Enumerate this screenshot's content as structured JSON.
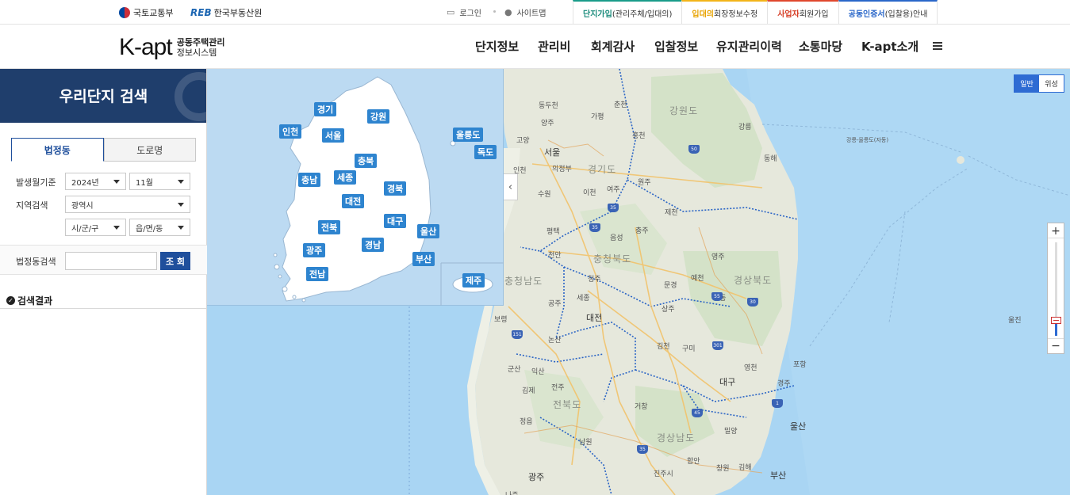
{
  "utility": {
    "gov_name": "국토교통부",
    "reb_mark": "REB",
    "reb_name": "한국부동산원",
    "login": "로그인",
    "sitemap": "사이트맵"
  },
  "tabs": [
    {
      "hl": "단지가입",
      "rest": "(관리주체/입대의)"
    },
    {
      "hl": "입대의",
      "rest": "회장정보수정"
    },
    {
      "hl": "사업자",
      "rest": " 회원가입"
    },
    {
      "hl": "공동인증서",
      "rest": "(입찰용)안내"
    }
  ],
  "header": {
    "logo_text": "K-apt",
    "logo_sub1": "공동주택관리",
    "logo_sub2": "정보시스템",
    "nav": [
      "단지정보",
      "관리비",
      "회계감사",
      "입찰정보",
      "유지관리이력",
      "소통마당",
      "K-apt소개"
    ]
  },
  "sidebar": {
    "title": "우리단지 검색",
    "tab_active": "법정동",
    "tab_other": "도로명",
    "period_label": "발생월기준",
    "year_value": "2024년",
    "month_value": "11월",
    "region_label": "지역검색",
    "sido_value": "광역시",
    "sigungu_value": "시/군/구",
    "emd_value": "읍/면/동",
    "dong_search_label": "법정동검색",
    "search_button": "조 회",
    "result_title": "검색결과"
  },
  "map": {
    "maptype_normal": "일반",
    "maptype_satellite": "위성",
    "collapse_arrow": "‹",
    "zoom_in": "+",
    "zoom_out": "−",
    "regions": [
      "경기",
      "강원",
      "인천",
      "서울",
      "울릉도",
      "독도",
      "충북",
      "충남",
      "세종",
      "경북",
      "대전",
      "대구",
      "전북",
      "울산",
      "경남",
      "광주",
      "부산",
      "전남",
      "제주"
    ],
    "provinces": [
      "강원도",
      "경기도",
      "충청북도",
      "충청남도",
      "경상북도",
      "전북도",
      "경상남도"
    ],
    "places": [
      "동두천",
      "춘천",
      "양주",
      "가평",
      "고양",
      "서울",
      "홍천",
      "강릉",
      "동해",
      "인천",
      "의정부",
      "수원",
      "이천",
      "여주",
      "원주",
      "제천",
      "평택",
      "음성",
      "충주",
      "천안",
      "청주",
      "영주",
      "공주",
      "세종",
      "대전",
      "문경",
      "예천",
      "안동",
      "보령",
      "상주",
      "논산",
      "김천",
      "구미",
      "군산",
      "익산",
      "영천",
      "대구",
      "경주",
      "김제",
      "전주",
      "포항",
      "정읍",
      "거창",
      "밀양",
      "울산",
      "남원",
      "창원",
      "김해",
      "부산",
      "진주시",
      "함안",
      "광주",
      "나주",
      "울진",
      "강릉-울릉도(자동)"
    ],
    "routes": [
      "50",
      "35",
      "35",
      "55",
      "30",
      "151",
      "301",
      "45",
      "1",
      "35"
    ]
  }
}
